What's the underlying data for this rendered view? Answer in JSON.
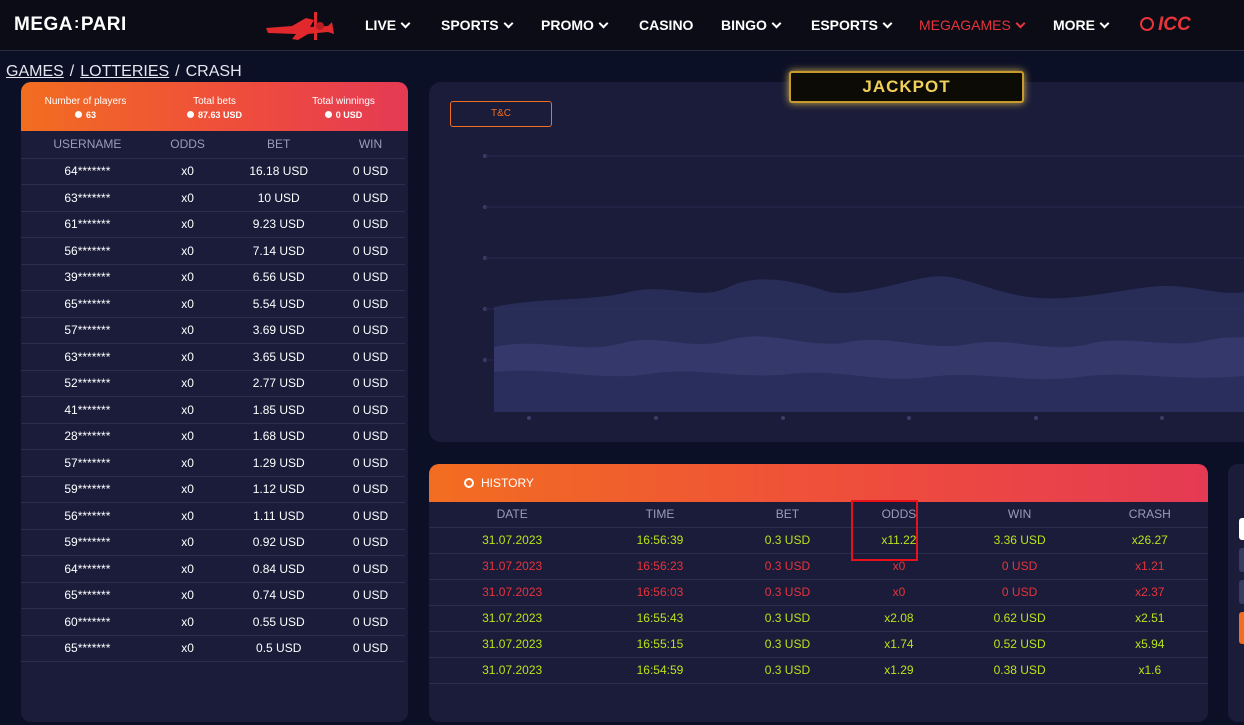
{
  "nav": {
    "logo_left": "MEGA",
    "logo_sep": ":",
    "logo_right": "PARI",
    "items": [
      "LIVE",
      "SPORTS",
      "PROMO",
      "CASINO",
      "BINGO",
      "ESPORTS",
      "MEGAGAMES",
      "MORE"
    ],
    "icc": "ICC"
  },
  "breadcrumb": {
    "games": "GAMES",
    "lotteries": "LOTTERIES",
    "crash": "CRASH",
    "sep": "/"
  },
  "players": {
    "stats": [
      {
        "label": "Number of players",
        "value": "63"
      },
      {
        "label": "Total bets",
        "value": "87.63 USD"
      },
      {
        "label": "Total winnings",
        "value": "0 USD"
      }
    ],
    "columns": [
      "USERNAME",
      "ODDS",
      "BET",
      "WIN"
    ],
    "rows": [
      [
        "64*******",
        "x0",
        "16.18 USD",
        "0 USD"
      ],
      [
        "63*******",
        "x0",
        "10 USD",
        "0 USD"
      ],
      [
        "61*******",
        "x0",
        "9.23 USD",
        "0 USD"
      ],
      [
        "56*******",
        "x0",
        "7.14 USD",
        "0 USD"
      ],
      [
        "39*******",
        "x0",
        "6.56 USD",
        "0 USD"
      ],
      [
        "65*******",
        "x0",
        "5.54 USD",
        "0 USD"
      ],
      [
        "57*******",
        "x0",
        "3.69 USD",
        "0 USD"
      ],
      [
        "63*******",
        "x0",
        "3.65 USD",
        "0 USD"
      ],
      [
        "52*******",
        "x0",
        "2.77 USD",
        "0 USD"
      ],
      [
        "41*******",
        "x0",
        "1.85 USD",
        "0 USD"
      ],
      [
        "28*******",
        "x0",
        "1.68 USD",
        "0 USD"
      ],
      [
        "57*******",
        "x0",
        "1.29 USD",
        "0 USD"
      ],
      [
        "59*******",
        "x0",
        "1.12 USD",
        "0 USD"
      ],
      [
        "56*******",
        "x0",
        "1.11 USD",
        "0 USD"
      ],
      [
        "59*******",
        "x0",
        "0.92 USD",
        "0 USD"
      ],
      [
        "64*******",
        "x0",
        "0.84 USD",
        "0 USD"
      ],
      [
        "65*******",
        "x0",
        "0.74 USD",
        "0 USD"
      ],
      [
        "60*******",
        "x0",
        "0.55 USD",
        "0 USD"
      ],
      [
        "65*******",
        "x0",
        "0.5 USD",
        "0 USD"
      ]
    ]
  },
  "game": {
    "tc_label": "T&C",
    "jackpot": "JACKPOT"
  },
  "history": {
    "title": "HISTORY",
    "columns": [
      "DATE",
      "TIME",
      "BET",
      "ODDS",
      "WIN",
      "CRASH"
    ],
    "rows": [
      {
        "status": "win",
        "cells": [
          "31.07.2023",
          "16:56:39",
          "0.3 USD",
          "x11.22",
          "3.36 USD",
          "x26.27"
        ]
      },
      {
        "status": "lose",
        "cells": [
          "31.07.2023",
          "16:56:23",
          "0.3 USD",
          "x0",
          "0 USD",
          "x1.21"
        ]
      },
      {
        "status": "lose",
        "cells": [
          "31.07.2023",
          "16:56:03",
          "0.3 USD",
          "x0",
          "0 USD",
          "x2.37"
        ]
      },
      {
        "status": "win",
        "cells": [
          "31.07.2023",
          "16:55:43",
          "0.3 USD",
          "x2.08",
          "0.62 USD",
          "x2.51"
        ]
      },
      {
        "status": "win",
        "cells": [
          "31.07.2023",
          "16:55:15",
          "0.3 USD",
          "x1.74",
          "0.52 USD",
          "x5.94"
        ]
      },
      {
        "status": "win",
        "cells": [
          "31.07.2023",
          "16:54:59",
          "0.3 USD",
          "x1.29",
          "0.38 USD",
          "x1.6"
        ]
      }
    ]
  },
  "colors": {
    "accent": "#f26d21",
    "accent2": "#e53a54",
    "win": "#b9e617",
    "lose": "#e8343a",
    "bg": "#0c1027",
    "panel": "#1a1c3a"
  }
}
